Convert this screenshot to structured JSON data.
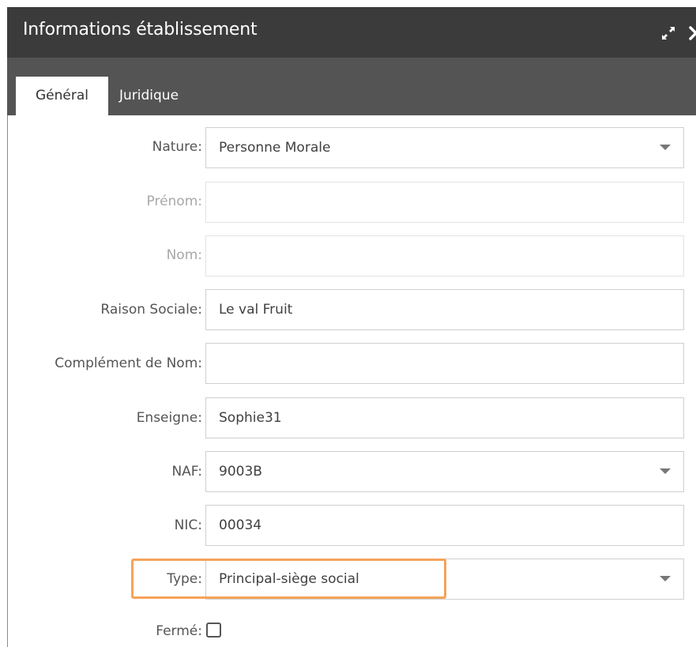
{
  "window": {
    "title": "Informations établissement",
    "icons": [
      "expand-icon",
      "close-icon"
    ]
  },
  "tabs": [
    {
      "label": "Général",
      "active": true
    },
    {
      "label": "Juridique",
      "active": false
    }
  ],
  "form": {
    "nature": {
      "label": "Nature:",
      "value": "Personne Morale"
    },
    "prenom": {
      "label": "Prénom:",
      "value": ""
    },
    "nom": {
      "label": "Nom:",
      "value": ""
    },
    "raison_sociale": {
      "label": "Raison Sociale:",
      "value": "Le val Fruit"
    },
    "complement_nom": {
      "label": "Complément de Nom:",
      "value": ""
    },
    "enseigne": {
      "label": "Enseigne:",
      "value": "Sophie31"
    },
    "naf": {
      "label": "NAF:",
      "value": "9003B"
    },
    "nic": {
      "label": "NIC:",
      "value": "00034"
    },
    "type": {
      "label": "Type:",
      "value": "Principal-siège social"
    },
    "ferme": {
      "label": "Fermé:",
      "checked": false
    }
  },
  "colors": {
    "titlebar": "#3b3b3b",
    "tabbar": "#545454",
    "highlight": "#f5a35b",
    "border_accent": "#5a97c7"
  }
}
